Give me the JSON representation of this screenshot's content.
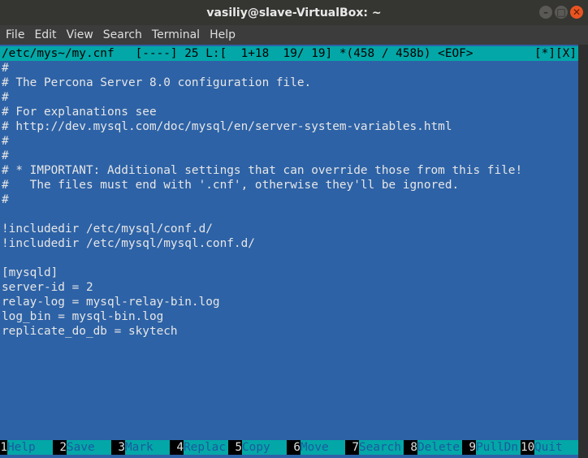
{
  "window": {
    "title": "vasiliy@slave-VirtualBox: ~",
    "buttons": {
      "minimize": "–",
      "maximize": "□",
      "close": "✕"
    }
  },
  "menu": [
    "File",
    "Edit",
    "View",
    "Search",
    "Terminal",
    "Help"
  ],
  "status": {
    "left": "/etc/mys~/my.cnf   [----] 25 L:[  1+18  19/ 19] *(458 / 458b) <EOF>",
    "right": "[*][X]"
  },
  "lines": [
    "#",
    "# The Percona Server 8.0 configuration file.",
    "#",
    "# For explanations see",
    "# http://dev.mysql.com/doc/mysql/en/server-system-variables.html",
    "#",
    "#",
    "# * IMPORTANT: Additional settings that can override those from this file!",
    "#   The files must end with '.cnf', otherwise they'll be ignored.",
    "#",
    "",
    "!includedir /etc/mysql/conf.d/",
    "!includedir /etc/mysql/mysql.conf.d/",
    "",
    "[mysqld]",
    "server-id = 2",
    "relay-log = mysql-relay-bin.log",
    "log_bin = mysql-bin.log",
    "replicate_do_db = skytech"
  ],
  "keys": [
    {
      "num": "1",
      "label": "Help"
    },
    {
      "num": "2",
      "label": "Save"
    },
    {
      "num": "3",
      "label": "Mark"
    },
    {
      "num": "4",
      "label": "Replac"
    },
    {
      "num": "5",
      "label": "Copy"
    },
    {
      "num": "6",
      "label": "Move"
    },
    {
      "num": "7",
      "label": "Search"
    },
    {
      "num": "8",
      "label": "Delete"
    },
    {
      "num": "9",
      "label": "PullDn"
    },
    {
      "num": "10",
      "label": "Quit"
    }
  ],
  "colors": {
    "editor_bg": "#2d62a6",
    "bar_bg": "#03a7a7",
    "text": "#e6e6e6",
    "close_button": "#e95420"
  }
}
